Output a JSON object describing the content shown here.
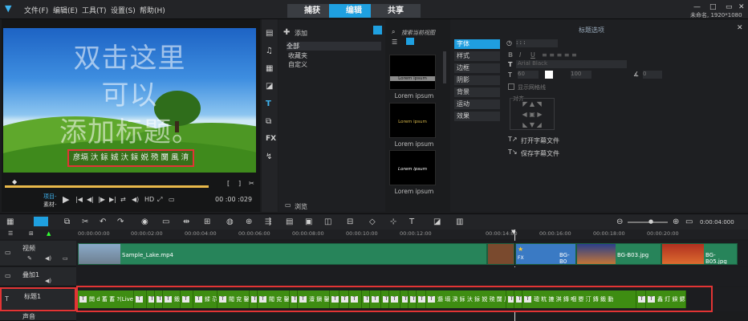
{
  "menu": {
    "file": "文件(F)",
    "edit": "编辑(E)",
    "tools": "工具(T)",
    "settings": "设置(S)",
    "help": "帮助(H)"
  },
  "tabs": {
    "capture": "捕获",
    "edit": "编辑",
    "share": "共享"
  },
  "project": {
    "info": "未命名, 1920*1080"
  },
  "preview": {
    "overlay_lines": [
      "双击这里",
      "可以",
      "添加标题。"
    ],
    "subtitle": "彦塥 汏 銢 娀 汏 銢 娧 殑 闅 風 淯",
    "mode_project": "项目-",
    "mode_clip": "素材-",
    "hd_label": "HD",
    "timecode": "00 :00 :029"
  },
  "library": {
    "add_label": "添加",
    "items": [
      "全部",
      "收藏夹",
      "自定义"
    ],
    "browse_label": "浏览"
  },
  "thumbs": {
    "search_placeholder": "搜索当前视图",
    "items": [
      "Lorem ipsum",
      "Lorem ipsum",
      "Lorem ipsum"
    ],
    "preview_texts": [
      "Lorem ipsum",
      "Lorem ipsum",
      "Lorem ipsum"
    ]
  },
  "options": {
    "title": "标题选项",
    "tabs": [
      "字体",
      "样式",
      "边框",
      "阴影",
      "背景",
      "运动",
      "效果"
    ],
    "font_name": "Arial Black",
    "font_size": "60",
    "line_spacing": "100",
    "angle": "0",
    "show_grid": "显示网格线",
    "align_label": "对齐",
    "open_file": "打开字幕文件",
    "save_file": "保存字幕文件"
  },
  "timeline": {
    "timecode": "0:00:04:000",
    "ruler": [
      "00:00:00:00",
      "00:00:02:00",
      "00:00:04:00",
      "00:00:06:00",
      "00:00:08:00",
      "00:00:10:00",
      "00:00:12:00",
      "00:00:14:00",
      "00:00:16:00",
      "00:00:18:00",
      "00:00:20:00"
    ],
    "tracks": {
      "video": "视频",
      "overlay": "叠加1",
      "title": "标题1",
      "voice": "声音"
    },
    "video_clips": [
      "Sample_Lake.mp4",
      "FX",
      "BG-B0",
      "BG-B03.jpg",
      "BG-B05.jpg"
    ],
    "title_clips": [
      "閧 d 蓄 蓄 ?(Live)",
      "",
      "",
      "",
      "鍛 鎠",
      "",
      "鍒 尕 悋",
      "閥 兖 鑿 鏄",
      "",
      "閥 兖 鑿 鏄",
      "",
      "澶 鎭 鑿 鐵",
      "",
      "",
      "",
      "",
      "",
      "",
      "",
      "",
      ",",
      "",
      "邎 塥 湀 銢 汏 銢 娧 殑 闅 風 淯",
      "",
      "",
      "璁 粇 摝 淇 鏄 嗰 瞾 汀 鏄 鍛 動",
      "",
      "鑫 灯 鍨 鍶 他 鍎 鉶"
    ]
  }
}
